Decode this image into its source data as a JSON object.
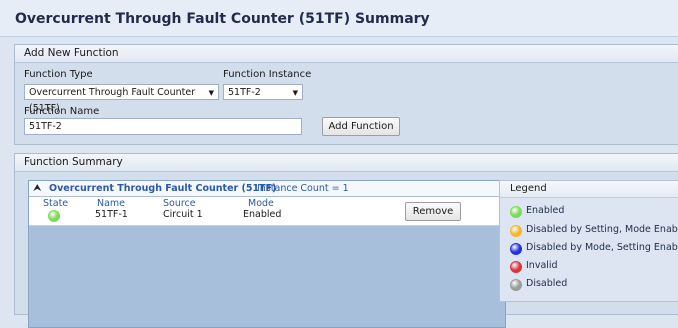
{
  "page_title": "Overcurrent Through Fault Counter (51TF) Summary",
  "add_function": {
    "header": "Add New Function",
    "function_type_label": "Function Type",
    "function_type_value": "Overcurrent Through Fault Counter (51TF)",
    "function_instance_label": "Function Instance",
    "function_instance_value": "51TF-2",
    "function_name_label": "Function Name",
    "function_name_value": "51TF-2",
    "add_button": "Add Function"
  },
  "summary": {
    "header": "Function Summary",
    "group_title": "Overcurrent Through Fault Counter (51TF)",
    "instance_count": "Instance Count = 1",
    "columns": [
      "State",
      "Name",
      "Source",
      "Mode"
    ],
    "rows": [
      {
        "state_color": "#7ed957",
        "name": "51TF-1",
        "source": "Circuit 1",
        "mode": "Enabled"
      }
    ],
    "remove_button": "Remove"
  },
  "legend": {
    "header": "Legend",
    "items": [
      {
        "label": "Enabled",
        "color": "#7ed957"
      },
      {
        "label": "Disabled by Setting, Mode Enabled",
        "color": "#f5b52d"
      },
      {
        "label": "Disabled by Mode, Setting Enabled",
        "color": "#2233dd"
      },
      {
        "label": "Invalid",
        "color": "#d9343a"
      },
      {
        "label": "Disabled",
        "color": "#9b9b9b"
      }
    ]
  }
}
